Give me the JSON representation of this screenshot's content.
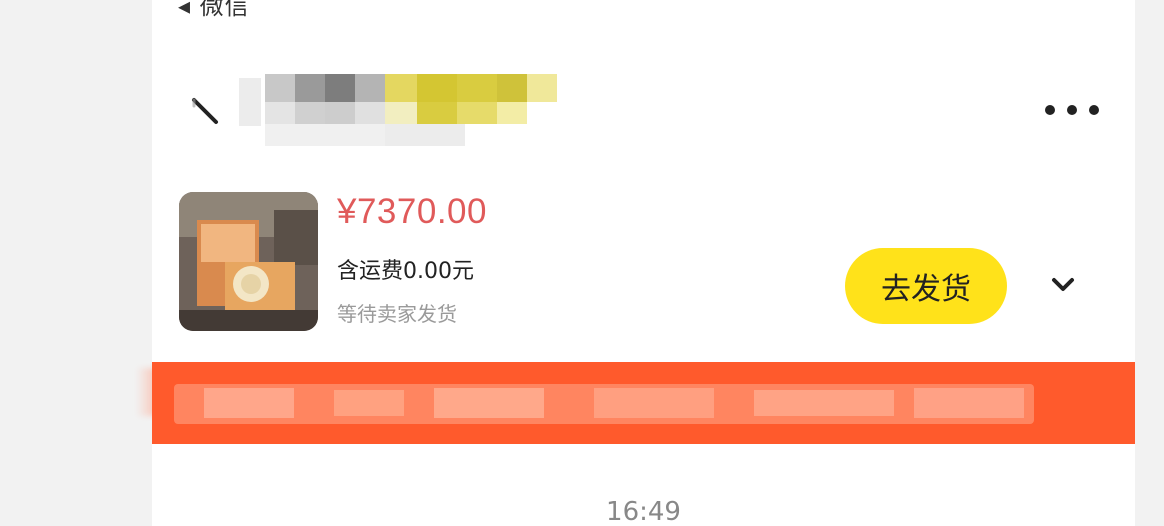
{
  "status_bar": {
    "back_label": "◂ 微信"
  },
  "header": {
    "title_redacted": true
  },
  "order": {
    "price": "¥7370.00",
    "shipping": "含运费0.00元",
    "status": "等待卖家发货",
    "action_label": "去发货"
  },
  "banner": {
    "color": "#ff5a2c",
    "redacted": true
  },
  "chat": {
    "timestamp": "16:49"
  },
  "colors": {
    "accent_yellow": "#ffe21a",
    "price_red": "#e05a5a",
    "banner_orange": "#ff5a2c"
  },
  "icons": [
    "back-arrow-icon",
    "more-icon",
    "chevron-down-icon",
    "product-thumbnail"
  ]
}
